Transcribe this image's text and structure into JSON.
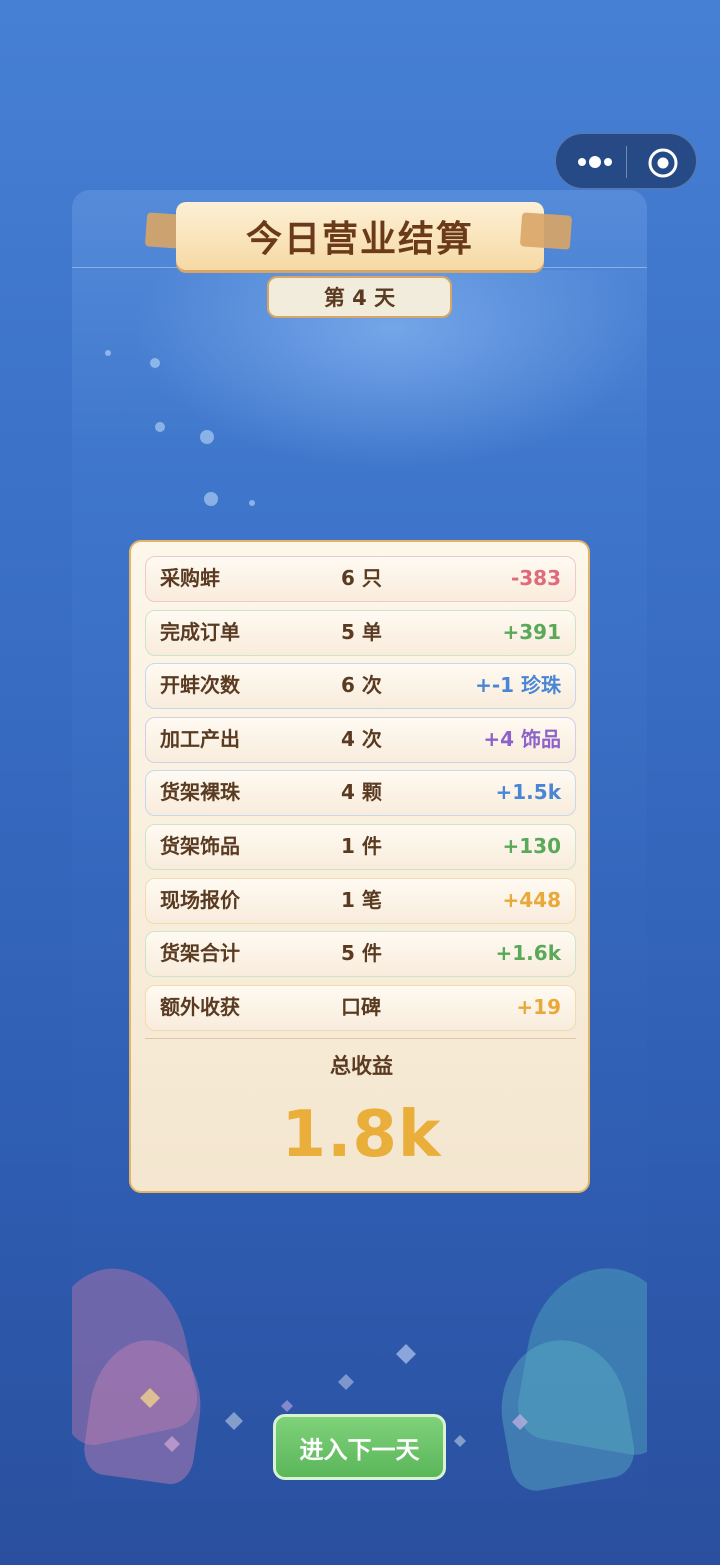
{
  "title": "今日营业结算",
  "day_label": "第 4 天",
  "rows": [
    {
      "label": "采购蚌",
      "count": "6 只",
      "value": "-383",
      "color": "#e06a7c",
      "border": "#f0c8cf"
    },
    {
      "label": "完成订单",
      "count": "5 单",
      "value": "+391",
      "color": "#5aa85a",
      "border": "#cfe3c8"
    },
    {
      "label": "开蚌次数",
      "count": "6 次",
      "value": "+-1 珍珠",
      "color": "#4a86d4",
      "border": "#c6d8ee"
    },
    {
      "label": "加工产出",
      "count": "4 次",
      "value": "+4 饰品",
      "color": "#8e62c8",
      "border": "#d8cbe8"
    },
    {
      "label": "货架裸珠",
      "count": "4 颗",
      "value": "+1.5k",
      "color": "#4a86d4",
      "border": "#c6d8ee"
    },
    {
      "label": "货架饰品",
      "count": "1 件",
      "value": "+130",
      "color": "#5aa85a",
      "border": "#cfe3c8"
    },
    {
      "label": "现场报价",
      "count": "1 笔",
      "value": "+448",
      "color": "#e8a83a",
      "border": "#f0dcb0"
    },
    {
      "label": "货架合计",
      "count": "5 件",
      "value": "+1.6k",
      "color": "#5aa85a",
      "border": "#cfe3c8"
    },
    {
      "label": "额外收获",
      "count": "口碑",
      "value": "+19",
      "color": "#e8a83a",
      "border": "#f0dcb0"
    }
  ],
  "total_label": "总收益",
  "total_value": "1.8k",
  "next_button": "进入下一天",
  "icons": {
    "menu": "more-dots-icon",
    "close": "close-miniprogram-icon"
  }
}
